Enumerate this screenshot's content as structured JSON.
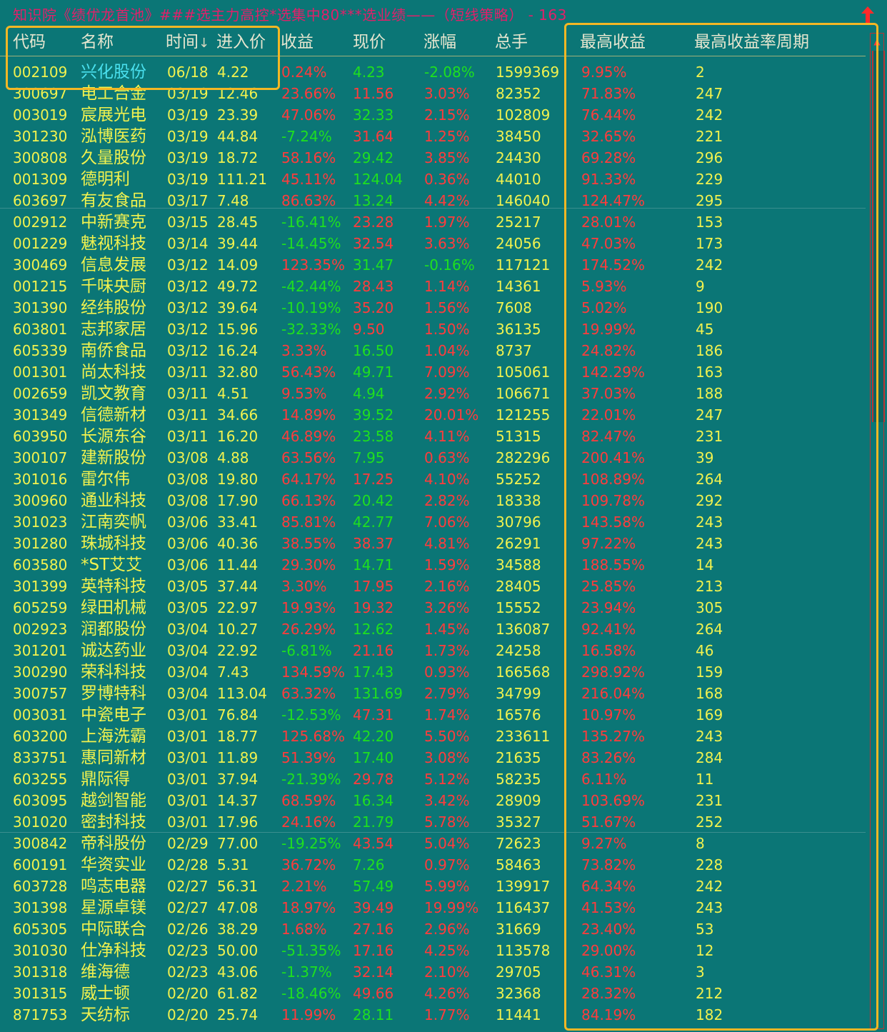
{
  "title": {
    "text": "知识院《绩优龙首池》###选主力高控*选集中80***选业绩——（短线策略） - 163",
    "up_icon": "up-arrow-icon"
  },
  "columns": [
    "代码",
    "名称",
    "时间",
    "进入价",
    "收益",
    "现价",
    "涨幅",
    "总手",
    "最高收益",
    "最高收益率周期"
  ],
  "sort_icon": "↓",
  "colors": {
    "background": "#0b7676",
    "yellow": "#f2f24e",
    "cyan": "#4ae0ee",
    "red": "#ff3c3c",
    "green": "#1fe01f",
    "highlight": "#f4b724"
  },
  "rows": [
    {
      "code": "002109",
      "name": "兴化股份",
      "time": "06/18",
      "entry": "4.22",
      "gain": "0.24%",
      "price": "4.23",
      "change": "-2.08%",
      "volume": "1599369",
      "max_gain": "9.95%",
      "period": "2"
    },
    {
      "code": "300697",
      "name": "电工合金",
      "time": "03/19",
      "entry": "12.46",
      "gain": "23.66%",
      "price": "11.56",
      "change": "3.03%",
      "volume": "82352",
      "max_gain": "71.83%",
      "period": "247"
    },
    {
      "code": "003019",
      "name": "宸展光电",
      "time": "03/19",
      "entry": "23.39",
      "gain": "47.06%",
      "price": "32.33",
      "change": "2.15%",
      "volume": "102809",
      "max_gain": "76.44%",
      "period": "242"
    },
    {
      "code": "301230",
      "name": "泓博医药",
      "time": "03/19",
      "entry": "44.84",
      "gain": "-7.24%",
      "price": "31.64",
      "change": "1.25%",
      "volume": "38450",
      "max_gain": "32.65%",
      "period": "221"
    },
    {
      "code": "300808",
      "name": "久量股份",
      "time": "03/19",
      "entry": "18.72",
      "gain": "58.16%",
      "price": "29.42",
      "change": "3.85%",
      "volume": "24430",
      "max_gain": "69.28%",
      "period": "296"
    },
    {
      "code": "001309",
      "name": "德明利",
      "time": "03/19",
      "entry": "111.21",
      "gain": "45.11%",
      "price": "124.04",
      "change": "0.36%",
      "volume": "44010",
      "max_gain": "91.33%",
      "period": "229"
    },
    {
      "code": "603697",
      "name": "有友食品",
      "time": "03/17",
      "entry": "7.48",
      "gain": "86.63%",
      "price": "13.24",
      "change": "4.42%",
      "volume": "146040",
      "max_gain": "124.47%",
      "period": "295"
    },
    {
      "code": "002912",
      "name": "中新赛克",
      "time": "03/15",
      "entry": "28.45",
      "gain": "-16.41%",
      "price": "23.28",
      "change": "1.97%",
      "volume": "25217",
      "max_gain": "28.01%",
      "period": "153"
    },
    {
      "code": "001229",
      "name": "魅视科技",
      "time": "03/14",
      "entry": "39.44",
      "gain": "-14.45%",
      "price": "32.54",
      "change": "3.63%",
      "volume": "24056",
      "max_gain": "47.03%",
      "period": "173"
    },
    {
      "code": "300469",
      "name": "信息发展",
      "time": "03/12",
      "entry": "14.09",
      "gain": "123.35%",
      "price": "31.47",
      "change": "-0.16%",
      "volume": "117121",
      "max_gain": "174.52%",
      "period": "242"
    },
    {
      "code": "001215",
      "name": "千味央厨",
      "time": "03/12",
      "entry": "49.72",
      "gain": "-42.44%",
      "price": "28.43",
      "change": "1.14%",
      "volume": "14361",
      "max_gain": "5.93%",
      "period": "9"
    },
    {
      "code": "301390",
      "name": "经纬股份",
      "time": "03/12",
      "entry": "39.64",
      "gain": "-10.19%",
      "price": "35.20",
      "change": "1.56%",
      "volume": "7608",
      "max_gain": "5.02%",
      "period": "190"
    },
    {
      "code": "603801",
      "name": "志邦家居",
      "time": "03/12",
      "entry": "15.96",
      "gain": "-32.33%",
      "price": "9.50",
      "change": "1.50%",
      "volume": "36135",
      "max_gain": "19.99%",
      "period": "45"
    },
    {
      "code": "605339",
      "name": "南侨食品",
      "time": "03/12",
      "entry": "16.24",
      "gain": "3.33%",
      "price": "16.50",
      "change": "1.04%",
      "volume": "8737",
      "max_gain": "24.82%",
      "period": "186"
    },
    {
      "code": "001301",
      "name": "尚太科技",
      "time": "03/11",
      "entry": "32.80",
      "gain": "56.43%",
      "price": "49.71",
      "change": "7.09%",
      "volume": "105061",
      "max_gain": "142.29%",
      "period": "163"
    },
    {
      "code": "002659",
      "name": "凯文教育",
      "time": "03/11",
      "entry": "4.51",
      "gain": "9.53%",
      "price": "4.94",
      "change": "2.92%",
      "volume": "106671",
      "max_gain": "37.03%",
      "period": "188"
    },
    {
      "code": "301349",
      "name": "信德新材",
      "time": "03/11",
      "entry": "34.66",
      "gain": "14.89%",
      "price": "39.52",
      "change": "20.01%",
      "volume": "121255",
      "max_gain": "22.01%",
      "period": "247"
    },
    {
      "code": "603950",
      "name": "长源东谷",
      "time": "03/11",
      "entry": "16.20",
      "gain": "46.89%",
      "price": "23.58",
      "change": "4.11%",
      "volume": "51315",
      "max_gain": "82.47%",
      "period": "231"
    },
    {
      "code": "300107",
      "name": "建新股份",
      "time": "03/08",
      "entry": "4.88",
      "gain": "63.56%",
      "price": "7.95",
      "change": "0.63%",
      "volume": "282296",
      "max_gain": "200.41%",
      "period": "39"
    },
    {
      "code": "301016",
      "name": "雷尔伟",
      "time": "03/08",
      "entry": "19.80",
      "gain": "64.17%",
      "price": "17.25",
      "change": "4.10%",
      "volume": "55252",
      "max_gain": "108.89%",
      "period": "264"
    },
    {
      "code": "300960",
      "name": "通业科技",
      "time": "03/08",
      "entry": "17.90",
      "gain": "66.13%",
      "price": "20.42",
      "change": "2.82%",
      "volume": "18338",
      "max_gain": "109.78%",
      "period": "292"
    },
    {
      "code": "301023",
      "name": "江南奕帆",
      "time": "03/06",
      "entry": "33.41",
      "gain": "85.81%",
      "price": "42.77",
      "change": "7.06%",
      "volume": "30796",
      "max_gain": "143.58%",
      "period": "243"
    },
    {
      "code": "301280",
      "name": "珠城科技",
      "time": "03/06",
      "entry": "40.36",
      "gain": "38.55%",
      "price": "38.37",
      "change": "4.81%",
      "volume": "26291",
      "max_gain": "97.22%",
      "period": "243"
    },
    {
      "code": "603580",
      "name": "*ST艾艾",
      "time": "03/06",
      "entry": "11.44",
      "gain": "29.30%",
      "price": "14.71",
      "change": "1.59%",
      "volume": "34588",
      "max_gain": "188.55%",
      "period": "14"
    },
    {
      "code": "301399",
      "name": "英特科技",
      "time": "03/05",
      "entry": "37.44",
      "gain": "3.30%",
      "price": "17.95",
      "change": "2.16%",
      "volume": "28405",
      "max_gain": "25.85%",
      "period": "213"
    },
    {
      "code": "605259",
      "name": "绿田机械",
      "time": "03/05",
      "entry": "22.97",
      "gain": "19.93%",
      "price": "19.32",
      "change": "3.26%",
      "volume": "15552",
      "max_gain": "23.94%",
      "period": "305"
    },
    {
      "code": "002923",
      "name": "润都股份",
      "time": "03/04",
      "entry": "10.27",
      "gain": "26.29%",
      "price": "12.62",
      "change": "1.45%",
      "volume": "136087",
      "max_gain": "92.41%",
      "period": "264"
    },
    {
      "code": "301201",
      "name": "诚达药业",
      "time": "03/04",
      "entry": "22.92",
      "gain": "-6.81%",
      "price": "21.16",
      "change": "1.73%",
      "volume": "24258",
      "max_gain": "16.58%",
      "period": "46"
    },
    {
      "code": "300290",
      "name": "荣科科技",
      "time": "03/04",
      "entry": "7.43",
      "gain": "134.59%",
      "price": "17.43",
      "change": "0.93%",
      "volume": "166568",
      "max_gain": "298.92%",
      "period": "159"
    },
    {
      "code": "300757",
      "name": "罗博特科",
      "time": "03/04",
      "entry": "113.04",
      "gain": "63.32%",
      "price": "131.69",
      "change": "2.79%",
      "volume": "34799",
      "max_gain": "216.04%",
      "period": "168"
    },
    {
      "code": "003031",
      "name": "中瓷电子",
      "time": "03/01",
      "entry": "76.84",
      "gain": "-12.53%",
      "price": "47.31",
      "change": "1.74%",
      "volume": "16576",
      "max_gain": "10.97%",
      "period": "169"
    },
    {
      "code": "603200",
      "name": "上海洗霸",
      "time": "03/01",
      "entry": "18.77",
      "gain": "125.68%",
      "price": "42.20",
      "change": "5.50%",
      "volume": "233611",
      "max_gain": "135.27%",
      "period": "243"
    },
    {
      "code": "833751",
      "name": "惠同新材",
      "time": "03/01",
      "entry": "11.89",
      "gain": "51.39%",
      "price": "17.40",
      "change": "3.08%",
      "volume": "21635",
      "max_gain": "83.26%",
      "period": "284"
    },
    {
      "code": "603255",
      "name": "鼎际得",
      "time": "03/01",
      "entry": "37.94",
      "gain": "-21.39%",
      "price": "29.78",
      "change": "5.12%",
      "volume": "58235",
      "max_gain": "6.11%",
      "period": "11"
    },
    {
      "code": "603095",
      "name": "越剑智能",
      "time": "03/01",
      "entry": "14.37",
      "gain": "68.59%",
      "price": "16.34",
      "change": "3.42%",
      "volume": "28909",
      "max_gain": "103.69%",
      "period": "231"
    },
    {
      "code": "301020",
      "name": "密封科技",
      "time": "03/01",
      "entry": "17.96",
      "gain": "24.16%",
      "price": "21.79",
      "change": "5.78%",
      "volume": "35327",
      "max_gain": "51.67%",
      "period": "252"
    },
    {
      "code": "300842",
      "name": "帝科股份",
      "time": "02/29",
      "entry": "77.00",
      "gain": "-19.25%",
      "price": "43.54",
      "change": "5.04%",
      "volume": "72623",
      "max_gain": "9.27%",
      "period": "8"
    },
    {
      "code": "600191",
      "name": "华资实业",
      "time": "02/28",
      "entry": "5.31",
      "gain": "36.72%",
      "price": "7.26",
      "change": "0.97%",
      "volume": "58463",
      "max_gain": "73.82%",
      "period": "228"
    },
    {
      "code": "603728",
      "name": "鸣志电器",
      "time": "02/27",
      "entry": "56.31",
      "gain": "2.21%",
      "price": "57.49",
      "change": "5.99%",
      "volume": "139917",
      "max_gain": "64.34%",
      "period": "242"
    },
    {
      "code": "301398",
      "name": "星源卓镁",
      "time": "02/27",
      "entry": "47.08",
      "gain": "18.97%",
      "price": "39.49",
      "change": "19.99%",
      "volume": "116437",
      "max_gain": "41.53%",
      "period": "243"
    },
    {
      "code": "605305",
      "name": "中际联合",
      "time": "02/26",
      "entry": "38.29",
      "gain": "1.68%",
      "price": "27.16",
      "change": "2.96%",
      "volume": "31669",
      "max_gain": "23.40%",
      "period": "53"
    },
    {
      "code": "301030",
      "name": "仕净科技",
      "time": "02/23",
      "entry": "50.00",
      "gain": "-51.35%",
      "price": "17.16",
      "change": "4.25%",
      "volume": "113578",
      "max_gain": "29.00%",
      "period": "12"
    },
    {
      "code": "301318",
      "name": "维海德",
      "time": "02/23",
      "entry": "43.06",
      "gain": "-1.37%",
      "price": "32.14",
      "change": "2.10%",
      "volume": "29705",
      "max_gain": "46.31%",
      "period": "3"
    },
    {
      "code": "301315",
      "name": "威士顿",
      "time": "02/20",
      "entry": "61.82",
      "gain": "-18.46%",
      "price": "49.66",
      "change": "4.26%",
      "volume": "32368",
      "max_gain": "28.32%",
      "period": "212"
    },
    {
      "code": "871753",
      "name": "天纺标",
      "time": "02/20",
      "entry": "25.74",
      "gain": "11.99%",
      "price": "28.11",
      "change": "1.77%",
      "volume": "11441",
      "max_gain": "84.19%",
      "period": "182"
    }
  ]
}
